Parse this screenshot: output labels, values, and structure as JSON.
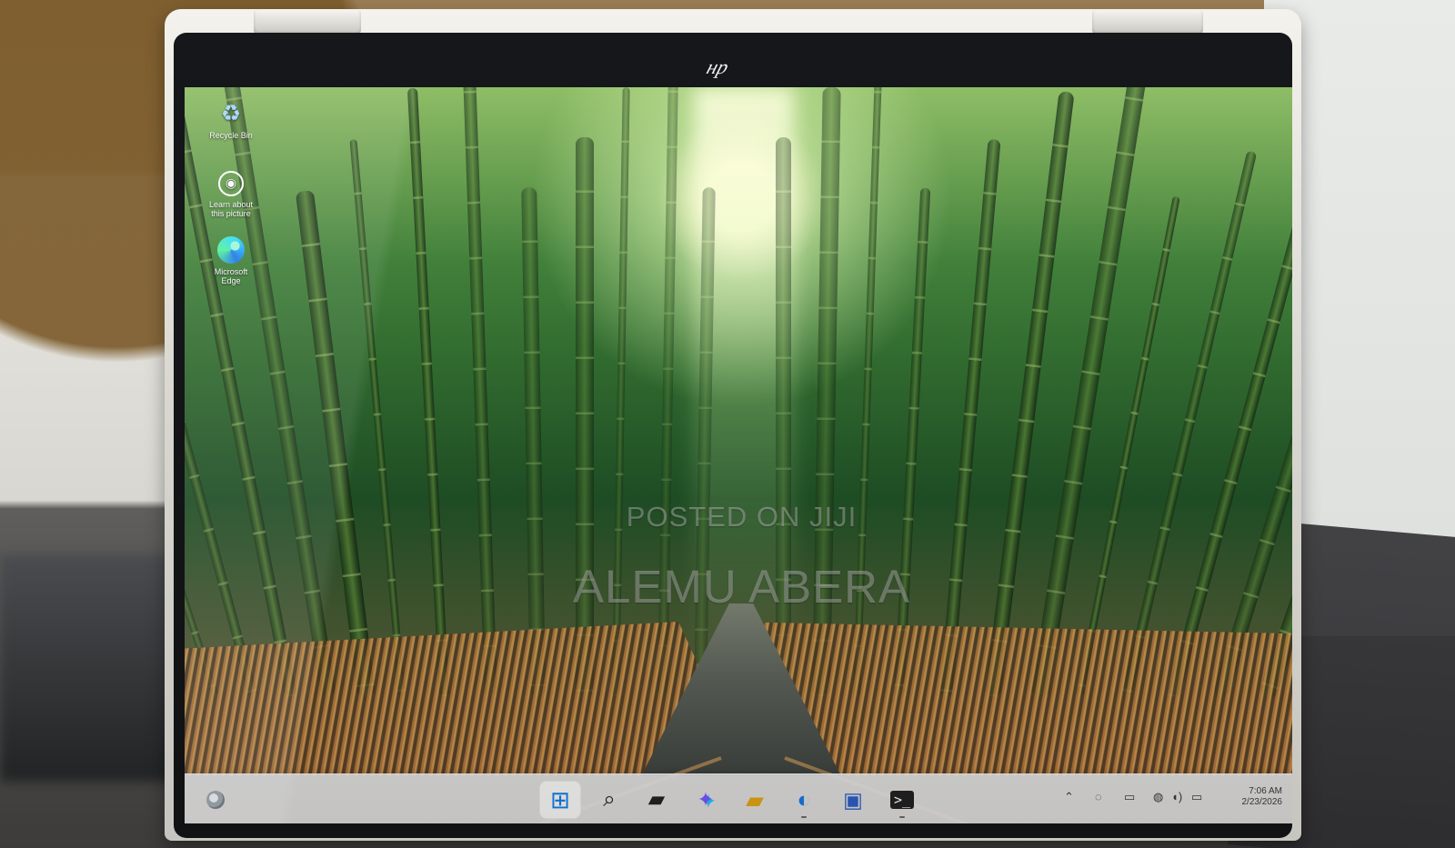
{
  "desktop": {
    "icons": [
      {
        "name": "recycle-bin",
        "label": "Recycle Bin",
        "icon": "recycle-bin-icon"
      },
      {
        "name": "learn-picture",
        "label": "Learn about\nthis picture",
        "icon": "camera-icon"
      },
      {
        "name": "microsoft-edge",
        "label": "Microsoft\nEdge",
        "icon": "edge-icon"
      }
    ],
    "watermark_top": "POSTED ON JIJI",
    "watermark_bottom": "ALEMU ABERA"
  },
  "taskbar": {
    "apps": [
      {
        "name": "start",
        "icon": "windows-start-icon"
      },
      {
        "name": "search",
        "icon": "search-icon"
      },
      {
        "name": "task-view",
        "icon": "task-view-icon"
      },
      {
        "name": "copilot",
        "icon": "copilot-icon"
      },
      {
        "name": "file-explorer",
        "icon": "folder-icon"
      },
      {
        "name": "edge",
        "icon": "edge-icon"
      },
      {
        "name": "microsoft-store",
        "icon": "store-icon"
      },
      {
        "name": "terminal",
        "icon": "terminal-icon"
      }
    ],
    "clock": {
      "time": "7:06 AM",
      "date": "2/23/2026"
    }
  },
  "colors": {
    "taskbar": "#EBECEF",
    "accent": "#137FE8",
    "wallpaper_green": "#3D7D36",
    "wallpaper_brown": "#7B5A38"
  }
}
